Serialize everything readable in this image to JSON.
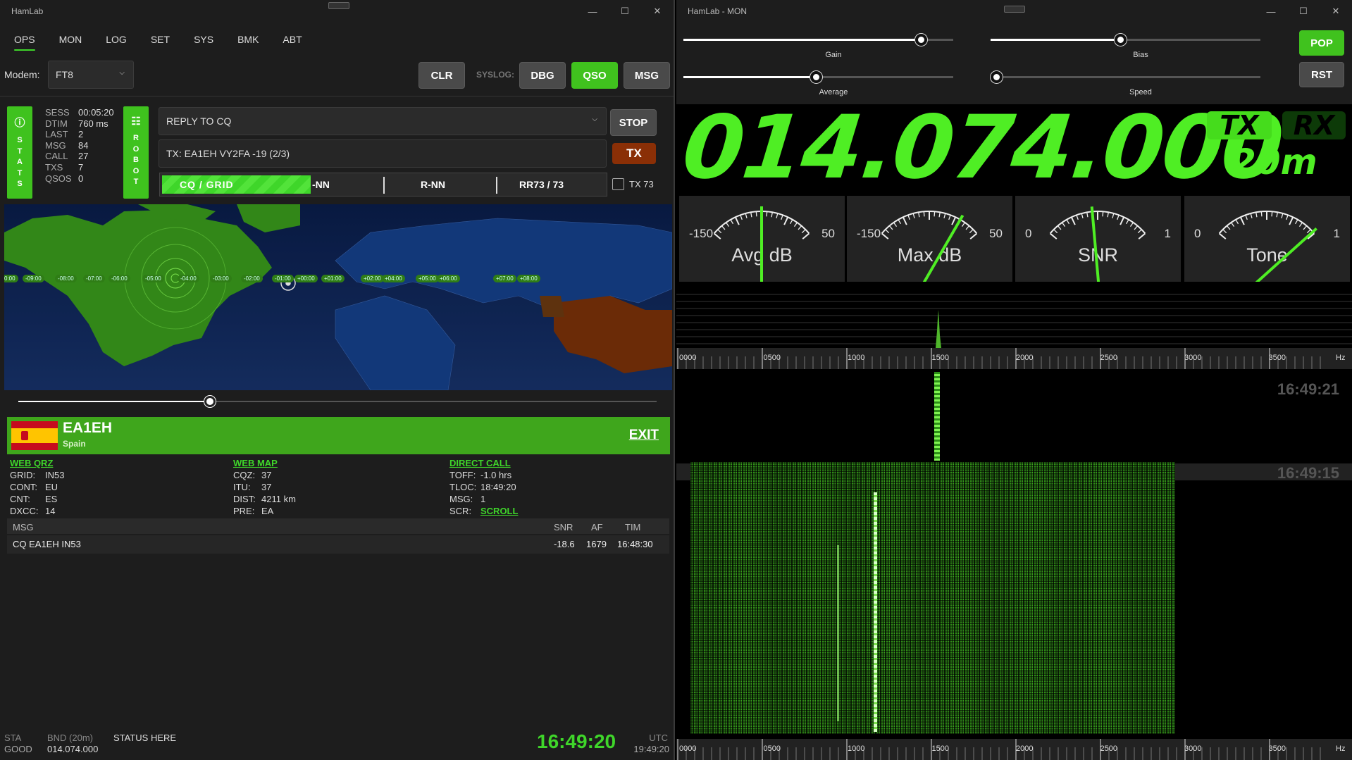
{
  "ops": {
    "title": "HamLab",
    "window_controls": [
      "—",
      "☐",
      "✕"
    ],
    "tabs": [
      "OPS",
      "MON",
      "LOG",
      "SET",
      "SYS",
      "BMK",
      "ABT"
    ],
    "modem_label": "Modem:",
    "modem_value": "FT8",
    "buttons": {
      "clr": "CLR",
      "syslog": "SYSLOG:",
      "dbg": "DBG",
      "qso": "QSO",
      "msg": "MSG",
      "stop": "STOP",
      "tx": "TX"
    },
    "stats_badge": [
      "S",
      "T",
      "A",
      "T",
      "S"
    ],
    "robot_badge": [
      "R",
      "O",
      "B",
      "O",
      "T"
    ],
    "stats": [
      {
        "k": "SESS",
        "v": "00:05:20"
      },
      {
        "k": "DTIM",
        "v": "760 ms"
      },
      {
        "k": "LAST",
        "v": "2"
      },
      {
        "k": "MSG",
        "v": "84"
      },
      {
        "k": "CALL",
        "v": "27"
      },
      {
        "k": "TXS",
        "v": "7"
      },
      {
        "k": "QSOS",
        "v": "0"
      }
    ],
    "reply_select": "REPLY TO CQ",
    "tx_message": "TX: EA1EH VY2FA -19 (2/3)",
    "sequence": [
      "CQ / GRID",
      "-NN",
      "R-NN",
      "RR73 / 73"
    ],
    "tx73_label": "TX 73",
    "timezones": [
      "0:00",
      "-09:00",
      "-08:00",
      "-07:00",
      "-06:00",
      "-05:00",
      "-04:00",
      "-03:00",
      "-02:00",
      "-01:00",
      "+00:00",
      "+01:00",
      "+02:00",
      "+04:00",
      "+05:00",
      "+06:00",
      "+07:00",
      "+08:00"
    ],
    "slider_value": 0.3,
    "callsign": "EA1EH",
    "country": "Spain",
    "exit": "EXIT",
    "links": {
      "qrz": "WEB QRZ",
      "map": "WEB MAP",
      "direct": "DIRECT CALL",
      "scroll": "SCROLL"
    },
    "info_col1": [
      {
        "k": "GRID:",
        "v": "IN53"
      },
      {
        "k": "CONT:",
        "v": "EU"
      },
      {
        "k": "CNT:",
        "v": "ES"
      },
      {
        "k": "DXCC:",
        "v": "14"
      }
    ],
    "info_col2": [
      {
        "k": "CQZ:",
        "v": "37"
      },
      {
        "k": "ITU:",
        "v": "37"
      },
      {
        "k": "DIST:",
        "v": "4211 km"
      },
      {
        "k": "PRE:",
        "v": "EA"
      }
    ],
    "info_col3": [
      {
        "k": "TOFF:",
        "v": "-1.0 hrs"
      },
      {
        "k": "TLOC:",
        "v": "18:49:20"
      },
      {
        "k": "MSG:",
        "v": "1"
      },
      {
        "k": "SCR:",
        "v": ""
      }
    ],
    "table_headers": {
      "msg": "MSG",
      "snr": "SNR",
      "af": "AF",
      "tim": "TIM"
    },
    "table_rows": [
      {
        "msg": "CQ EA1EH IN53",
        "snr": "-18.6",
        "af": "1679",
        "tim": "16:48:30"
      }
    ],
    "status": {
      "sta_label": "STA",
      "sta_value": "GOOD",
      "bnd_label": "BND (20m)",
      "bnd_value": "014.074.000",
      "status_text": "STATUS HERE",
      "clock": "16:49:20",
      "utc_label": "UTC",
      "utc_value": "19:49:20"
    }
  },
  "mon": {
    "title": "HamLab - MON",
    "window_controls": [
      "—",
      "☐",
      "✕"
    ],
    "sliders": {
      "gain": {
        "label": "Gain",
        "value": 0.88
      },
      "bias": {
        "label": "Bias",
        "value": 0.48
      },
      "average": {
        "label": "Average",
        "value": 0.49
      },
      "speed": {
        "label": "Speed",
        "value": 0.02
      }
    },
    "buttons": {
      "pop": "POP",
      "rst": "RST"
    },
    "frequency": "014.074.000",
    "tx_badge": "TX",
    "rx_badge": "RX",
    "band": "20m",
    "meters": [
      {
        "name": "Avg dB",
        "min": "-150",
        "max": "50",
        "level": 0.5
      },
      {
        "name": "Max dB",
        "min": "-150",
        "max": "50",
        "level": 0.8
      },
      {
        "name": "SNR",
        "min": "0",
        "max": "1",
        "level": 0.45
      },
      {
        "name": "Tone",
        "min": "0",
        "max": "1",
        "level": 0.98
      }
    ],
    "axis_ticks": [
      "0000",
      "0500",
      "1000",
      "1500",
      "2000",
      "2500",
      "3000",
      "3500"
    ],
    "axis_unit": "Hz",
    "timestamps": [
      "16:49:21",
      "16:49:15"
    ]
  },
  "colors": {
    "accent": "#3fd62a",
    "freq": "#4fee24",
    "tx_btn": "#8a2f06"
  }
}
